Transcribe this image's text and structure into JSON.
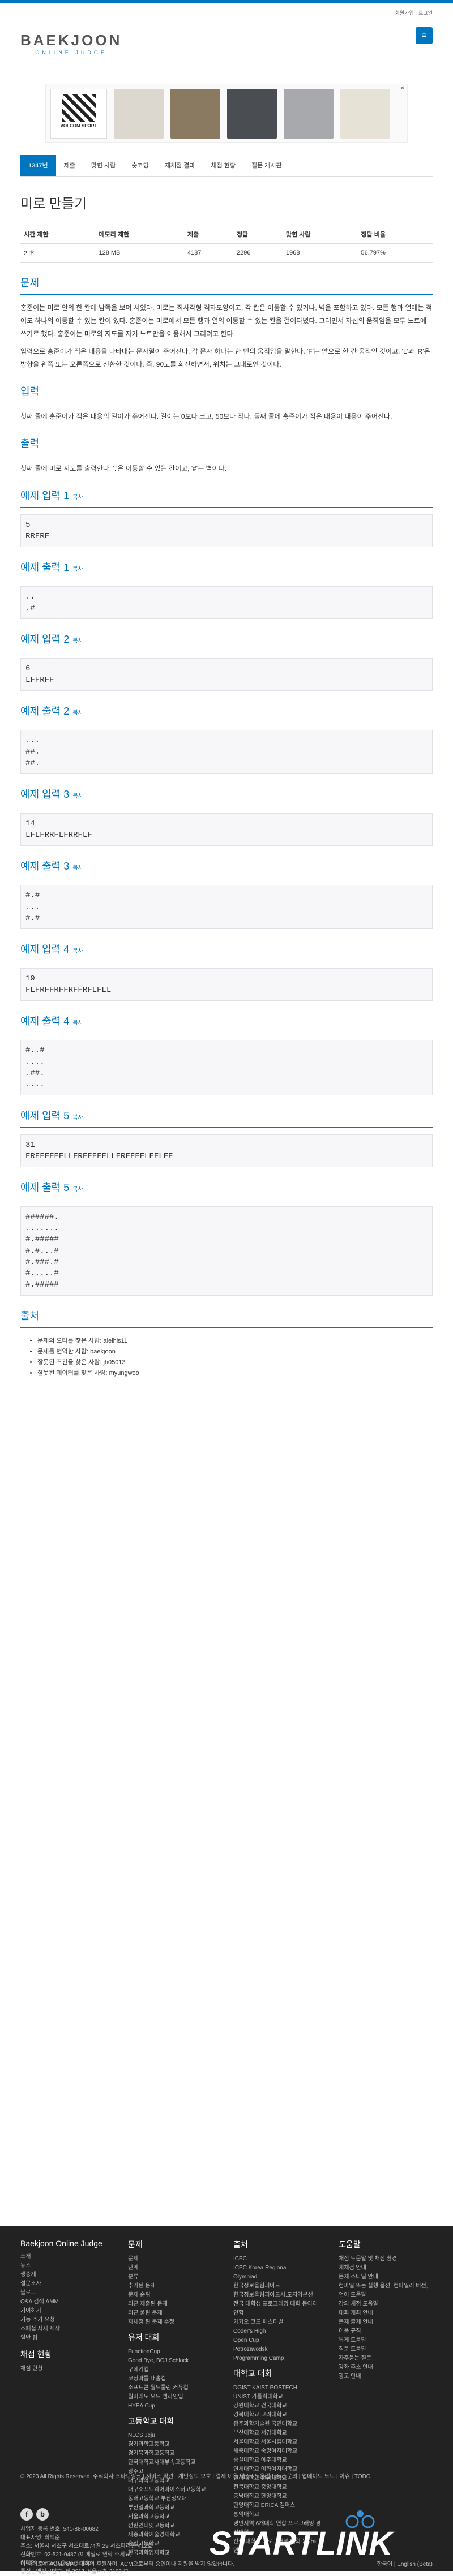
{
  "header": {
    "links": [
      "회원가입",
      "로그인"
    ],
    "logo_main": "BAEKJOON",
    "logo_sub": "ONLINE JUDGE"
  },
  "ad": {
    "brand": "VOLCOM SPORT",
    "close": "✕"
  },
  "nav": {
    "tabs": [
      "1347번",
      "제출",
      "맞힌 사람",
      "숏코딩",
      "재채점 결과",
      "채점 현황",
      "질문 게시판"
    ]
  },
  "problem": {
    "title": "미로 만들기",
    "info_headers": [
      "시간 제한",
      "메모리 제한",
      "제출",
      "정답",
      "맞힌 사람",
      "정답 비율"
    ],
    "info_values": [
      "2 초",
      "128 MB",
      "4187",
      "2296",
      "1968",
      "56.797%"
    ],
    "desc_title": "문제",
    "desc_p1": "홍준이는 미로 안의 한 칸에 남쪽을 보며 서있다. 미로는 직사각형 격자모양이고, 각 칸은 이동할 수 있거나, 벽을 포함하고 있다. 모든 행과 열에는 적어도 하나의 이동할 수 있는 칸이 있다. 홍준이는 미로에서 모든 행과 열의 이동할 수 있는 칸을 걸어다녔다. 그러면서 자신의 움직임을 모두 노트에 쓰기로 했다. 홍준이는 미로의 지도를 자기 노트만을 이용해서 그리려고 한다.",
    "desc_p2": "입력으로 홍준이가 적은 내용을 나타내는 문자열이 주어진다. 각 문자 하나는 한 번의 움직임을 말한다. 'F'는 앞으로 한 칸 움직인 것이고, 'L'과 'R'은 방향을 왼쪽 또는 오른쪽으로 전환한 것이다. 즉, 90도를 회전하면서, 위치는 그대로인 것이다.",
    "input_title": "입력",
    "input_desc": "첫째 줄에 홍준이가 적은 내용의 길이가 주어진다. 길이는 0보다 크고, 50보다 작다. 둘째 줄에 홍준이가 적은 내용이 내용이 주어진다.",
    "output_title": "출력",
    "output_desc": "첫째 줄에 미로 지도를 출력한다. '.'은 이동할 수 있는 칸이고, '#'는 벽이다.",
    "copy_label": "복사"
  },
  "samples": [
    {
      "in_title": "예제 입력 1",
      "in": "5\nRRFRF",
      "out_title": "예제 출력 1",
      "out": "..\n.#"
    },
    {
      "in_title": "예제 입력 2",
      "in": "6\nLFFRFF",
      "out_title": "예제 출력 2",
      "out": "...\n##.\n##."
    },
    {
      "in_title": "예제 입력 3",
      "in": "14\nLFLFRRFLFRRFLF",
      "out_title": "예제 출력 3",
      "out": "#.#\n...\n#.#"
    },
    {
      "in_title": "예제 입력 4",
      "in": "19\nFLFRFFRFFRFFRFLFLL",
      "out_title": "예제 출력 4",
      "out": "#..#\n....\n.##.\n...."
    },
    {
      "in_title": "예제 입력 5",
      "in": "31\nFRFFFFFFLLFRFFFFFLLFRFFFFLFFLFF",
      "out_title": "예제 출력 5",
      "out": "######.\n.......\n#.#####\n#.#...#\n#.###.#\n#.....#\n#.#####"
    }
  ],
  "source": {
    "title": "출처",
    "items": [
      "문제의 오타를 찾은 사람: alelhis11",
      "문제를 번역한 사람: baekjoon",
      "잘못된 조건을 찾은 사람: jh05013",
      "잘못된 데이터를 찾은 사람: myungwoo"
    ]
  },
  "footer": {
    "col1_title": "Baekjoon Online Judge",
    "col1": [
      "소개",
      "뉴스",
      "생중계",
      "설문조사",
      "블로그",
      "Q&A 검색 AMM",
      "기여하기",
      "기능 추가 요청",
      "스페셜 저지 제작",
      "일반 링"
    ],
    "col1b_title": "채점 현황",
    "col1b": [
      "채점 현황"
    ],
    "col2_title": "문제",
    "col2": [
      "문제",
      "단계",
      "분류",
      "추가된 문제",
      "문제 순위",
      "최근 제출된 문제",
      "최근 풀린 문제",
      "재채점 된 문제 수정"
    ],
    "col2b_title": "유저 대회",
    "col2b": [
      "FunctionCup",
      "Good Bye, BOJ Schlock",
      "구데기컵",
      "코딩마를 내홀컵",
      "소프트콘 월드룰린 커뮤컵",
      "월미래도 오드 엠라인입",
      "HYEA Cup"
    ],
    "col2c_title": "고등학교 대회",
    "col2c": [
      "NLCS Jeju",
      "경기과학고등학교",
      "경기북과학고등학교",
      "단국대학교사대부속고등학교",
      "광주고",
      "대구과학고등학교",
      "대구소프트웨어마이스터고등학교",
      "동래고등학교 부산정보대",
      "부산일과학고등학교",
      "서울과학고등학교",
      "선린인터넷고등학교",
      "세종과학예술영재학교",
      "숭실고등학교",
      "한국과학영재학교"
    ],
    "col3_title": "출처",
    "col3": [
      "ICPC",
      "ICPC Korea Regional",
      "Olympiad",
      "한국정보올림피아드",
      "한국정보올림피아드시.도지역본선",
      "전국 대학생 프로그래밍 대회 동아리 연합",
      "카카오 코드 페스티벌",
      "Coder's High",
      "Open Cup",
      "Petrozavodsk",
      "Programming Camp"
    ],
    "col3b_title": "대학교 대회",
    "col3b": [
      "DGIST KAIST POSTECH",
      "UNIST 가톨릭대학교",
      "강원대학교 건국대학교",
      "경북대학교 고려대학교",
      "광주과학기술원 국민대학교",
      "부산대학교 서강대학교",
      "서울대학교 서울시립대학교",
      "세종대학교 숙명여자대학교",
      "숭실대학교 아주대학교",
      "연세대학교 이화여자대학교",
      "인하대학교 전남대학교",
      "전북대학교 중앙대학교",
      "충남대학교 한양대학교",
      "한양대학교 ERICA 캠퍼스",
      "홍익대학교",
      "경인지역 6개대학 연합 프로그래밍 경시대회",
      "전국 대학생 프로그래밍 대회 동아리 연합"
    ],
    "col4_title": "도움말",
    "col4": [
      "채점 도움말 및 채점 환경",
      "재채점 안내",
      "문제 스타일 안내",
      "컴파일 또는 실행 옵션, 컴파일러 버전, 언어 도움말",
      "강의 채점 도움말",
      "대회 개최 안내",
      "문제 출제 안내",
      "이용 규칙",
      "톡게 도움말",
      "질문 도움말",
      "자주묻는 질문",
      "강좌 주소 안내",
      "광고 안내"
    ],
    "bottom_links": "© 2023 All Rights Reserved. 주식회사 스타트링크 | 서비스 약관 | 개인정보 보호 | 결제 이용 약관 | 도움말 | 광고 문의 | 업데이트 노트 | 이슈 | TODO",
    "biz": [
      "사업자 등록 번호: 541-88-00682",
      "대표자명: 최백준",
      "주소: 서울시 서초구 서초대로74길 29 서초파라곤 412호",
      "전화번호: 02-521-0487 (이메일로 연락 주세요)",
      "이메일: contacts@startlink.io",
      "통신판매신고번호: 제 2017-서울서초-2193 호"
    ],
    "copyright": "이 사이트는 ACM-ICPC 대회의 후원하며, ACM으로부터 승인이나 지원을 받지 않았습니다.",
    "lang": "한국어 | English (Beta)",
    "startlink": "STARTLINK"
  }
}
